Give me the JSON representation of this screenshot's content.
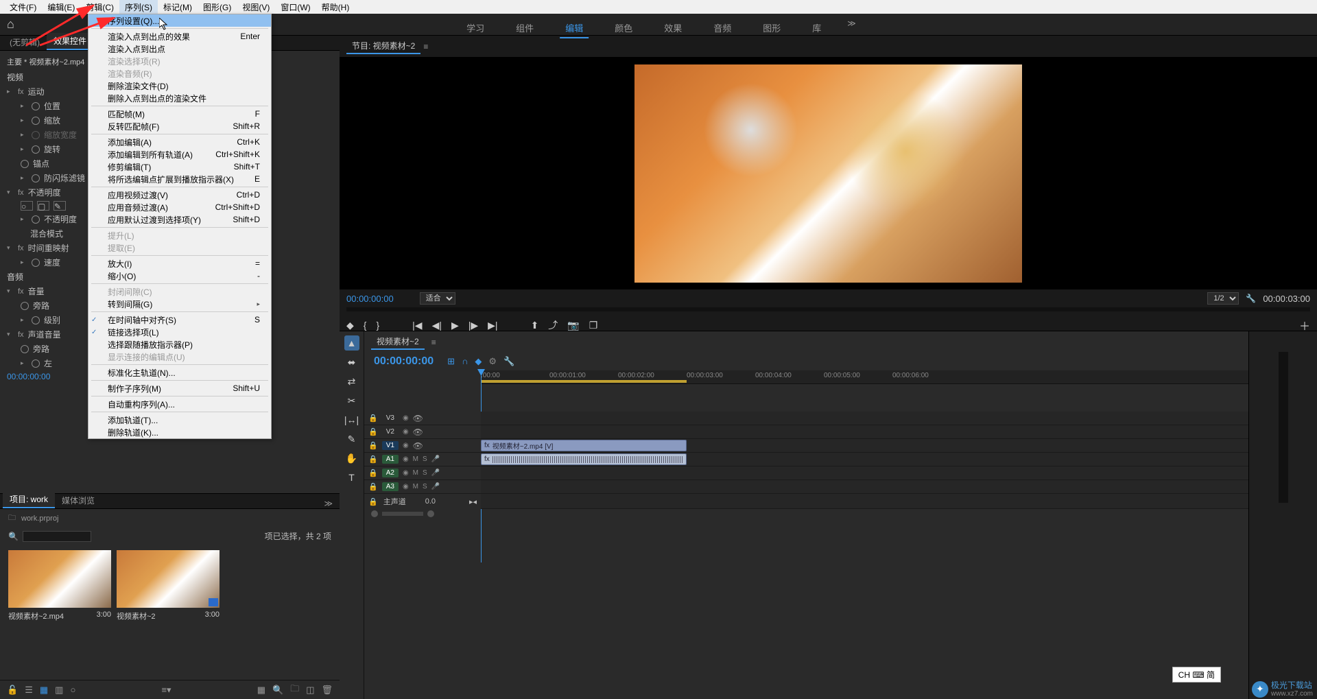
{
  "menubar": {
    "file": "文件(F)",
    "edit": "编辑(E)",
    "clip": "剪辑(C)",
    "sequence": "序列(S)",
    "markers": "标记(M)",
    "graphics": "图形(G)",
    "view": "视图(V)",
    "window": "窗口(W)",
    "help": "帮助(H)"
  },
  "dropdown": {
    "sequence_settings": "序列设置(Q)...",
    "render_in_out_effects": "渲染入点到出点的效果",
    "render_in_out_effects_sc": "Enter",
    "render_in_out": "渲染入点到出点",
    "render_selection": "渲染选择项(R)",
    "render_audio": "渲染音频(R)",
    "delete_render_files": "删除渲染文件(D)",
    "delete_in_out_render": "删除入点到出点的渲染文件",
    "match_frame": "匹配帧(M)",
    "match_frame_sc": "F",
    "reverse_match_frame": "反转匹配帧(F)",
    "reverse_match_frame_sc": "Shift+R",
    "add_edit": "添加编辑(A)",
    "add_edit_sc": "Ctrl+K",
    "add_edit_all": "添加编辑到所有轨道(A)",
    "add_edit_all_sc": "Ctrl+Shift+K",
    "trim_edit": "修剪编辑(T)",
    "trim_edit_sc": "Shift+T",
    "extend_to_playhead": "将所选编辑点扩展到播放指示器(X)",
    "extend_to_playhead_sc": "E",
    "apply_video_trans": "应用视频过渡(V)",
    "apply_video_trans_sc": "Ctrl+D",
    "apply_audio_trans": "应用音频过渡(A)",
    "apply_audio_trans_sc": "Ctrl+Shift+D",
    "apply_default_trans": "应用默认过渡到选择项(Y)",
    "apply_default_trans_sc": "Shift+D",
    "lift": "提升(L)",
    "extract": "提取(E)",
    "zoom_in": "放大(I)",
    "zoom_in_sc": "=",
    "zoom_out": "缩小(O)",
    "zoom_out_sc": "-",
    "close_gap": "封闭间隙(C)",
    "go_to_gap": "转到间隔(G)",
    "snap_in_timeline": "在时间轴中对齐(S)",
    "snap_in_timeline_sc": "S",
    "linked_selection": "链接选择项(L)",
    "selection_follows": "选择跟随播放指示器(P)",
    "show_through_edits": "显示连接的编辑点(U)",
    "normalize_master": "标准化主轨道(N)...",
    "make_subsequence": "制作子序列(M)",
    "make_subsequence_sc": "Shift+U",
    "auto_reframe": "自动重构序列(A)...",
    "add_tracks": "添加轨道(T)...",
    "delete_tracks": "删除轨道(K)..."
  },
  "workspace_tabs": {
    "learning": "学习",
    "assembly": "组件",
    "editing": "编辑",
    "color": "颜色",
    "effects": "效果",
    "audio": "音频",
    "graphics": "图形",
    "libraries": "库"
  },
  "left_tabs": {
    "no_clip": "(无剪辑)",
    "effect_controls": "效果控件"
  },
  "effect_controls": {
    "master_clip": "主要 * 视频素材~2.mp4",
    "video_section": "视频",
    "motion": "运动",
    "position": "位置",
    "scale": "缩放",
    "scale_width": "缩放宽度",
    "rotation": "旋转",
    "anchor": "锚点",
    "anti_flicker": "防闪烁滤镜",
    "opacity": "不透明度",
    "opacity_val": "不透明度",
    "blend_mode": "混合模式",
    "time_remap": "时间重映射",
    "speed": "速度",
    "audio_section": "音频",
    "volume": "音量",
    "bypass": "旁路",
    "level": "级别",
    "channel_volume": "声道音量",
    "bypass2": "旁路",
    "left": "左",
    "tc": "00:00:00:00"
  },
  "project_tabs": {
    "project": "项目: work",
    "media_browser": "媒体浏览"
  },
  "project": {
    "filename": "work.prproj",
    "selection_info": "项已选择，共 2 项",
    "icon_folder": "📁",
    "search_placeholder": "",
    "item1_name": "视频素材~2.mp4",
    "item1_dur": "3:00",
    "item2_name": "视频素材~2",
    "item2_dur": "3:00"
  },
  "program": {
    "title": "节目: 视频素材~2",
    "tc_left": "00:00:00:00",
    "fit": "适合",
    "zoom": "1/2",
    "duration": "00:00:03:00"
  },
  "timeline": {
    "title": "视频素材~2",
    "tc": "00:00:00:00",
    "ruler": {
      "t0": ":00:00",
      "t1": "00:00:01:00",
      "t2": "00:00:02:00",
      "t3": "00:00:03:00",
      "t4": "00:00:04:00",
      "t5": "00:00:05:00",
      "t6": "00:00:06:00"
    },
    "tracks": {
      "v3": "V3",
      "v2": "V2",
      "v1": "V1",
      "a1": "A1",
      "a2": "A2",
      "a3": "A3",
      "m": "M",
      "s": "S",
      "master": "主声道",
      "master_val": "0.0"
    },
    "clip_v": "视频素材~2.mp4 [V]",
    "clip_a": ""
  },
  "ime": {
    "text": "CH ⌨ 简"
  },
  "watermark": {
    "text1": "极光下载站",
    "text2": "www.xz7.com"
  },
  "icons": {
    "home": "⌂",
    "more": "≫",
    "search": "🔍",
    "folder": "🗀",
    "list": "☰",
    "icon_view": "▦",
    "new": "◫",
    "trash": "🗑",
    "lock": "🔓",
    "wrench": "🔧",
    "marker": "◆",
    "in": "{",
    "out": "}",
    "goto_in": "|◀",
    "step_back": "◀|",
    "play": "▶",
    "step_fwd": "|▶",
    "goto_out": "▶|",
    "lift": "⬆",
    "extract": "⤴",
    "export": "📷",
    "comp": "❐",
    "plus": "＋"
  }
}
